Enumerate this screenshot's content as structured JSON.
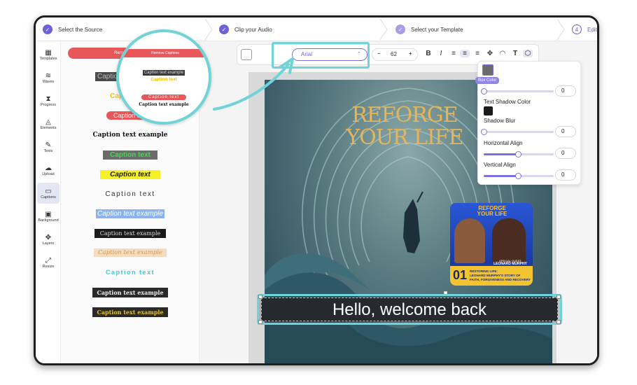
{
  "steps": [
    {
      "label": "Select the Source",
      "state": "done"
    },
    {
      "label": "Clip your Audio",
      "state": "done"
    },
    {
      "label": "Select your Template",
      "state": "done"
    },
    {
      "label": "Edit",
      "number": "4",
      "state": "current"
    }
  ],
  "rail": [
    {
      "label": "Templates",
      "icon": "grid-icon"
    },
    {
      "label": "Waves",
      "icon": "wave-icon"
    },
    {
      "label": "Progress",
      "icon": "hourglass-icon"
    },
    {
      "label": "Elements",
      "icon": "shapes-icon"
    },
    {
      "label": "Texts",
      "icon": "pen-icon"
    },
    {
      "label": "Upload",
      "icon": "cloud-upload-icon"
    },
    {
      "label": "Captions",
      "icon": "captions-icon"
    },
    {
      "label": "Background",
      "icon": "image-icon"
    },
    {
      "label": "Layers",
      "icon": "move-icon"
    },
    {
      "label": "Resize",
      "icon": "resize-icon"
    }
  ],
  "captions": {
    "remove_label": "Remove Captions",
    "styles": [
      "Caption text example",
      "Caption text",
      "Caption text",
      "Caption text example",
      "Caption text",
      "Caption text",
      "Caption text",
      "Caption text example",
      "Caption text example",
      "Caption text example",
      "Caption text",
      "Caption text example",
      "Caption text example"
    ]
  },
  "magnifier": {
    "remove_label": "Remove Captions",
    "items": [
      "Caption text example",
      "Caption text",
      "Caption text",
      "Caption text example"
    ]
  },
  "toolbar": {
    "font": "Arial",
    "font_size": "62",
    "minus": "−",
    "plus": "+",
    "bold": "B",
    "italic": "I",
    "text_tool": "T"
  },
  "props": {
    "box_color_tooltip": "Box Color",
    "box_color": "#6b6b6b",
    "box_slider_value": "0",
    "text_shadow_color_label": "Text Shadow Color",
    "shadow_color": "#1b1b1b",
    "shadow_blur_label": "Shadow Blur",
    "shadow_blur_value": "0",
    "horizontal_align_label": "Horizontal Align",
    "horizontal_align_value": "0",
    "vertical_align_label": "Vertical Align",
    "vertical_align_value": "0"
  },
  "poster": {
    "title_line1": "REFORGE",
    "title_line2": "YOUR LIFE",
    "caption": "Hello, welcome back"
  },
  "episode": {
    "title_line1": "REFORGE",
    "title_line2": "YOUR LIFE",
    "number": "01",
    "guest_label": "SPECIAL GUEST",
    "guest_name": "LEONARD MURPHY",
    "desc_line1": "RESTORING LIFE:",
    "desc_line2": "LEONARD MURPHY'S STORY OF",
    "desc_line3": "FAITH, FORGIVENESS AND RECOVERY"
  },
  "colors": {
    "accent": "#6e63d6",
    "highlight": "#6fd3d8",
    "remove_red": "#e8585a"
  }
}
